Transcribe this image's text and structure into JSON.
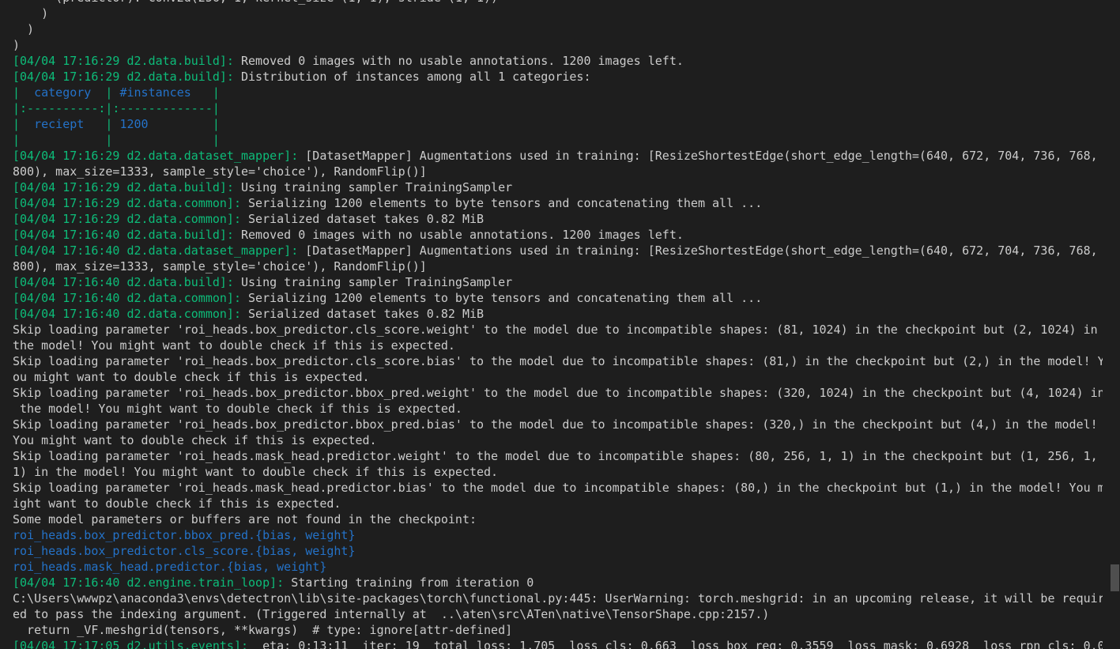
{
  "terminal": {
    "lines": [
      {
        "segments": [
          {
            "text": "      (predictor): Conv2d(256, 1, kernel_size=(1, 1), stride=(1, 1))",
            "style": "default"
          }
        ]
      },
      {
        "segments": [
          {
            "text": "    )",
            "style": "default"
          }
        ]
      },
      {
        "segments": [
          {
            "text": "  )",
            "style": "default"
          }
        ]
      },
      {
        "segments": [
          {
            "text": ")",
            "style": "default"
          }
        ]
      },
      {
        "segments": [
          {
            "text": "[04/04 17:16:29 d2.data.build]: ",
            "style": "green"
          },
          {
            "text": "Removed 0 images with no usable annotations. 1200 images left.",
            "style": "default"
          }
        ]
      },
      {
        "segments": [
          {
            "text": "[04/04 17:16:29 d2.data.build]: ",
            "style": "green"
          },
          {
            "text": "Distribution of instances among all 1 categories:",
            "style": "default"
          }
        ]
      },
      {
        "segments": [
          {
            "text": "|  ",
            "style": "green"
          },
          {
            "text": "category",
            "style": "blue"
          },
          {
            "text": "  | ",
            "style": "green"
          },
          {
            "text": "#instances",
            "style": "blue"
          },
          {
            "text": "   |",
            "style": "green"
          }
        ]
      },
      {
        "segments": [
          {
            "text": "|:----------:|:-------------|",
            "style": "green"
          }
        ]
      },
      {
        "segments": [
          {
            "text": "|  ",
            "style": "green"
          },
          {
            "text": "reciept",
            "style": "blue"
          },
          {
            "text": "   | ",
            "style": "green"
          },
          {
            "text": "1200",
            "style": "blue"
          },
          {
            "text": "         |",
            "style": "green"
          }
        ]
      },
      {
        "segments": [
          {
            "text": "|            |              |",
            "style": "green"
          }
        ]
      },
      {
        "segments": [
          {
            "text": "[04/04 17:16:29 d2.data.dataset_mapper]: ",
            "style": "green"
          },
          {
            "text": "[DatasetMapper] Augmentations used in training: [ResizeShortestEdge(short_edge_length=(640, 672, 704, 736, 768,",
            "style": "default"
          }
        ]
      },
      {
        "segments": [
          {
            "text": "800), max_size=1333, sample_style='choice'), RandomFlip()]",
            "style": "default"
          }
        ]
      },
      {
        "segments": [
          {
            "text": "[04/04 17:16:29 d2.data.build]: ",
            "style": "green"
          },
          {
            "text": "Using training sampler TrainingSampler",
            "style": "default"
          }
        ]
      },
      {
        "segments": [
          {
            "text": "[04/04 17:16:29 d2.data.common]: ",
            "style": "green"
          },
          {
            "text": "Serializing 1200 elements to byte tensors and concatenating them all ...",
            "style": "default"
          }
        ]
      },
      {
        "segments": [
          {
            "text": "[04/04 17:16:29 d2.data.common]: ",
            "style": "green"
          },
          {
            "text": "Serialized dataset takes 0.82 MiB",
            "style": "default"
          }
        ]
      },
      {
        "segments": [
          {
            "text": "[04/04 17:16:40 d2.data.build]: ",
            "style": "green"
          },
          {
            "text": "Removed 0 images with no usable annotations. 1200 images left.",
            "style": "default"
          }
        ]
      },
      {
        "segments": [
          {
            "text": "[04/04 17:16:40 d2.data.dataset_mapper]: ",
            "style": "green"
          },
          {
            "text": "[DatasetMapper] Augmentations used in training: [ResizeShortestEdge(short_edge_length=(640, 672, 704, 736, 768,",
            "style": "default"
          }
        ]
      },
      {
        "segments": [
          {
            "text": "800), max_size=1333, sample_style='choice'), RandomFlip()]",
            "style": "default"
          }
        ]
      },
      {
        "segments": [
          {
            "text": "[04/04 17:16:40 d2.data.build]: ",
            "style": "green"
          },
          {
            "text": "Using training sampler TrainingSampler",
            "style": "default"
          }
        ]
      },
      {
        "segments": [
          {
            "text": "[04/04 17:16:40 d2.data.common]: ",
            "style": "green"
          },
          {
            "text": "Serializing 1200 elements to byte tensors and concatenating them all ...",
            "style": "default"
          }
        ]
      },
      {
        "segments": [
          {
            "text": "[04/04 17:16:40 d2.data.common]: ",
            "style": "green"
          },
          {
            "text": "Serialized dataset takes 0.82 MiB",
            "style": "default"
          }
        ]
      },
      {
        "segments": [
          {
            "text": "Skip loading parameter 'roi_heads.box_predictor.cls_score.weight' to the model due to incompatible shapes: (81, 1024) in the checkpoint but (2, 1024) in",
            "style": "default"
          }
        ]
      },
      {
        "segments": [
          {
            "text": "the model! You might want to double check if this is expected.",
            "style": "default"
          }
        ]
      },
      {
        "segments": [
          {
            "text": "Skip loading parameter 'roi_heads.box_predictor.cls_score.bias' to the model due to incompatible shapes: (81,) in the checkpoint but (2,) in the model! Y",
            "style": "default"
          }
        ]
      },
      {
        "segments": [
          {
            "text": "ou might want to double check if this is expected.",
            "style": "default"
          }
        ]
      },
      {
        "segments": [
          {
            "text": "Skip loading parameter 'roi_heads.box_predictor.bbox_pred.weight' to the model due to incompatible shapes: (320, 1024) in the checkpoint but (4, 1024) in",
            "style": "default"
          }
        ]
      },
      {
        "segments": [
          {
            "text": " the model! You might want to double check if this is expected.",
            "style": "default"
          }
        ]
      },
      {
        "segments": [
          {
            "text": "Skip loading parameter 'roi_heads.box_predictor.bbox_pred.bias' to the model due to incompatible shapes: (320,) in the checkpoint but (4,) in the model!",
            "style": "default"
          }
        ]
      },
      {
        "segments": [
          {
            "text": "You might want to double check if this is expected.",
            "style": "default"
          }
        ]
      },
      {
        "segments": [
          {
            "text": "Skip loading parameter 'roi_heads.mask_head.predictor.weight' to the model due to incompatible shapes: (80, 256, 1, 1) in the checkpoint but (1, 256, 1,",
            "style": "default"
          }
        ]
      },
      {
        "segments": [
          {
            "text": "1) in the model! You might want to double check if this is expected.",
            "style": "default"
          }
        ]
      },
      {
        "segments": [
          {
            "text": "Skip loading parameter 'roi_heads.mask_head.predictor.bias' to the model due to incompatible shapes: (80,) in the checkpoint but (1,) in the model! You m",
            "style": "default"
          }
        ]
      },
      {
        "segments": [
          {
            "text": "ight want to double check if this is expected.",
            "style": "default"
          }
        ]
      },
      {
        "segments": [
          {
            "text": "Some model parameters or buffers are not found in the checkpoint:",
            "style": "default"
          }
        ]
      },
      {
        "segments": [
          {
            "text": "roi_heads.box_predictor.bbox_pred.{bias, weight}",
            "style": "blue"
          }
        ]
      },
      {
        "segments": [
          {
            "text": "roi_heads.box_predictor.cls_score.{bias, weight}",
            "style": "blue"
          }
        ]
      },
      {
        "segments": [
          {
            "text": "roi_heads.mask_head.predictor.{bias, weight}",
            "style": "blue"
          }
        ]
      },
      {
        "segments": [
          {
            "text": "[04/04 17:16:40 d2.engine.train_loop]: ",
            "style": "green"
          },
          {
            "text": "Starting training from iteration 0",
            "style": "default"
          }
        ]
      },
      {
        "segments": [
          {
            "text": "C:\\Users\\wwwpz\\anaconda3\\envs\\detectron\\lib\\site-packages\\torch\\functional.py:445: UserWarning: torch.meshgrid: in an upcoming release, it will be requir",
            "style": "default"
          }
        ]
      },
      {
        "segments": [
          {
            "text": "ed to pass the indexing argument. (Triggered internally at  ..\\aten\\src\\ATen\\native\\TensorShape.cpp:2157.)",
            "style": "default"
          }
        ]
      },
      {
        "segments": [
          {
            "text": "  return _VF.meshgrid(tensors, **kwargs)  # type: ignore[attr-defined]",
            "style": "default"
          }
        ]
      },
      {
        "segments": [
          {
            "text": "[04/04 17:17:05 d2.utils.events]: ",
            "style": "green"
          },
          {
            "text": " eta: 0:13:11  iter: 19  total_loss: 1.705  loss_cls: 0.663  loss_box_reg: 0.3559  loss_mask: 0.6928  loss_rpn_cls: 0.0",
            "style": "default"
          }
        ]
      }
    ]
  },
  "colors": {
    "background": "#1e1e1e",
    "default_text": "#cccccc",
    "log_prefix_green": "#0dbc79",
    "highlight_blue": "#2472c8",
    "scrollbar_thumb": "#4f4f4f"
  }
}
